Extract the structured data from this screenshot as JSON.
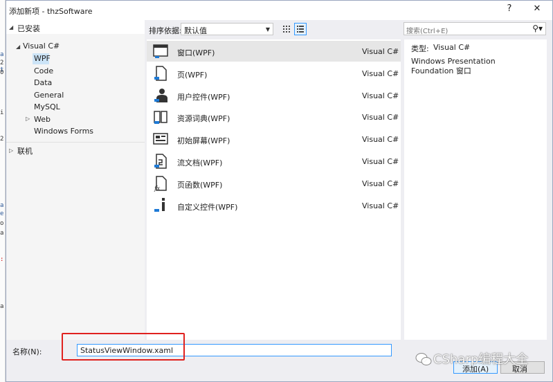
{
  "dialog": {
    "title": "添加新项 - thzSoftware",
    "help_glyph": "?",
    "close_glyph": "✕"
  },
  "tree": {
    "installed": "已安装",
    "visual_csharp": "Visual C#",
    "children": [
      "WPF",
      "Code",
      "Data",
      "General",
      "MySQL",
      "Web",
      "Windows Forms"
    ],
    "selected": "WPF",
    "online": "联机"
  },
  "toolbar": {
    "sort_label": "排序依据:",
    "sort_value": "默认值"
  },
  "search": {
    "placeholder": "搜索(Ctrl+E)",
    "icon_glyph": "⚲▾"
  },
  "templates": [
    {
      "name": "窗口(WPF)",
      "lang": "Visual C#",
      "icon": "window-icon"
    },
    {
      "name": "页(WPF)",
      "lang": "Visual C#",
      "icon": "page-icon"
    },
    {
      "name": "用户控件(WPF)",
      "lang": "Visual C#",
      "icon": "user-control-icon"
    },
    {
      "name": "资源词典(WPF)",
      "lang": "Visual C#",
      "icon": "resource-dictionary-icon"
    },
    {
      "name": "初始屏幕(WPF)",
      "lang": "Visual C#",
      "icon": "splash-screen-icon"
    },
    {
      "name": "流文档(WPF)",
      "lang": "Visual C#",
      "icon": "flow-document-icon"
    },
    {
      "name": "页函数(WPF)",
      "lang": "Visual C#",
      "icon": "page-function-icon"
    },
    {
      "name": "自定义控件(WPF)",
      "lang": "Visual C#",
      "icon": "custom-control-icon"
    }
  ],
  "details": {
    "type_label": "类型:",
    "type_value": "Visual C#",
    "description": "Windows Presentation Foundation 窗口"
  },
  "footer": {
    "name_label": "名称(N):",
    "name_value": "StatusViewWindow.xaml",
    "add_label": "添加(A)",
    "cancel_label": "取消"
  },
  "watermark": {
    "text": "CSharp编程大全"
  },
  "colors": {
    "accent": "#3399ff",
    "highlight_box": "#e0211e",
    "selection": "#cce4f7"
  }
}
